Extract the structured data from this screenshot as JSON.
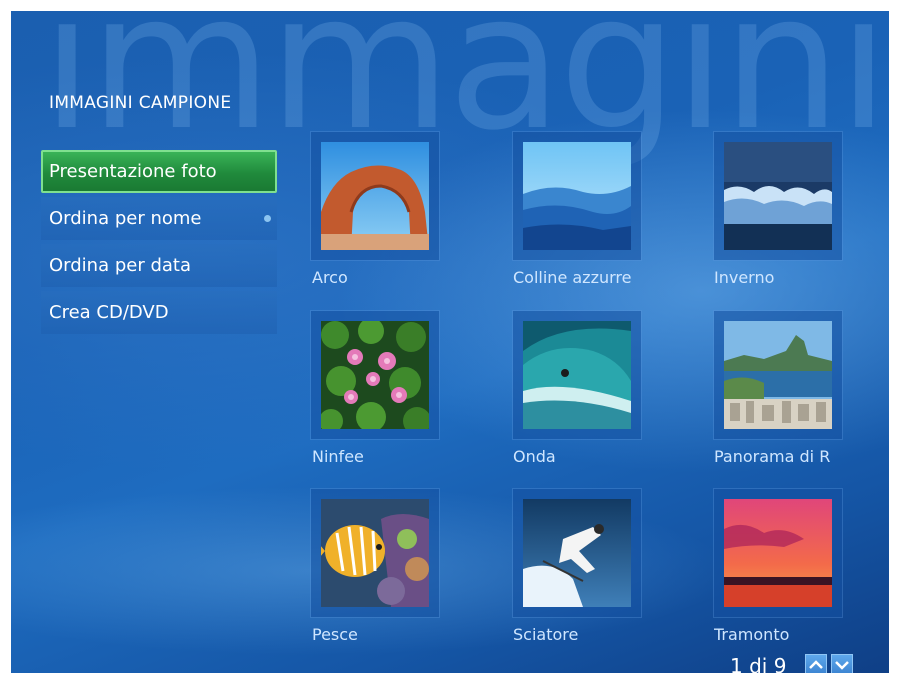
{
  "watermark": "immagini",
  "section_title": "IMMAGINI CAMPIONE",
  "menu": [
    {
      "label": "Presentazione foto",
      "selected": true
    },
    {
      "label": "Ordina per nome",
      "indicator": true
    },
    {
      "label": "Ordina per data"
    },
    {
      "label": "Crea CD/DVD"
    }
  ],
  "gallery": [
    {
      "caption": "Arco",
      "thumb": "arch-rock-photo"
    },
    {
      "caption": "Colline azzurre",
      "thumb": "blue-hills-photo"
    },
    {
      "caption": "Inverno",
      "thumb": "winter-photo"
    },
    {
      "caption": "Ninfee",
      "thumb": "water-lilies-photo"
    },
    {
      "caption": "Onda",
      "thumb": "wave-photo"
    },
    {
      "caption": "Panorama di R",
      "thumb": "city-panorama-photo"
    },
    {
      "caption": "Pesce",
      "thumb": "fish-photo"
    },
    {
      "caption": "Sciatore",
      "thumb": "skier-photo"
    },
    {
      "caption": "Tramonto",
      "thumb": "sunset-photo"
    }
  ],
  "pager": {
    "text": "1 di 9",
    "up_icon": "arrow-up-icon",
    "down_icon": "arrow-down-icon"
  },
  "colors": {
    "background": "#1a62b6",
    "selected_green": "#208a3c",
    "caption_text": "#cfe6ff"
  }
}
